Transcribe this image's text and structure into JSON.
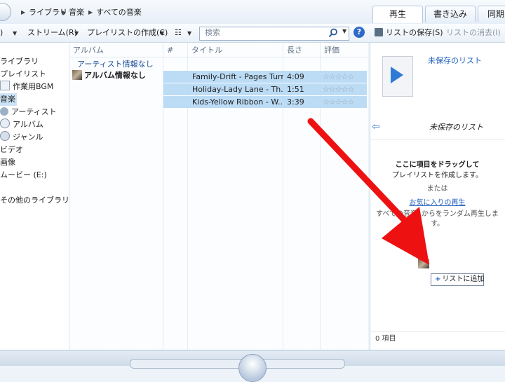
{
  "breadcrumb": [
    "ライブラリ",
    "音楽",
    "すべての音楽"
  ],
  "tabs": [
    {
      "label": "再生"
    },
    {
      "label": "書き込み"
    },
    {
      "label": "同期"
    }
  ],
  "toolbar": {
    "organize_partial": ")",
    "stream": "ストリーム(R)",
    "create_playlist": "プレイリストの作成(C)",
    "search_placeholder": "検索",
    "help": "?"
  },
  "list_toolbar": {
    "save": "リストの保存(S)",
    "clear": "リストの消去(I)"
  },
  "nav": {
    "library": "ライブラリ",
    "playlists": "プレイリスト",
    "playlist_item": "作業用BGM",
    "music": "音楽",
    "artist": "アーティスト",
    "album": "アルバム",
    "genre": "ジャンル",
    "video": "ビデオ",
    "pictures": "画像",
    "movie": "ムービー (E:)",
    "other_libraries": "その他のライブラリ"
  },
  "columns": {
    "album": "アルバム",
    "number": "#",
    "title": "タイトル",
    "length": "長さ",
    "rating": "評価"
  },
  "group": {
    "artist": "アーティスト情報なし",
    "album": "アルバム情報なし"
  },
  "tracks": [
    {
      "title": "Family-Drift - Pages Turn",
      "length": "4:09",
      "rating": 0
    },
    {
      "title": "Holiday-Lady Lane - Th...",
      "length": "1:51",
      "rating": 0
    },
    {
      "title": "Kids-Yellow Ribbon - W...",
      "length": "3:39",
      "rating": 0
    }
  ],
  "list_pane": {
    "unsaved_link": "未保存のリスト",
    "title": "未保存のリスト",
    "drag_hint_1": "ここに項目をドラッグして",
    "drag_hint_2": "プレイリストを作成します。",
    "or": "または",
    "favorites_link": "お気に入りの再生",
    "shuffle_hint_1": "すべての音楽' からをランダム再生しま",
    "shuffle_hint_2": "す。",
    "add_tooltip": "リストに追加",
    "count": "0 項目"
  },
  "colors": {
    "selection": "#bcdcf6",
    "link": "#1f5fbf",
    "arrow": "#ee1111"
  }
}
